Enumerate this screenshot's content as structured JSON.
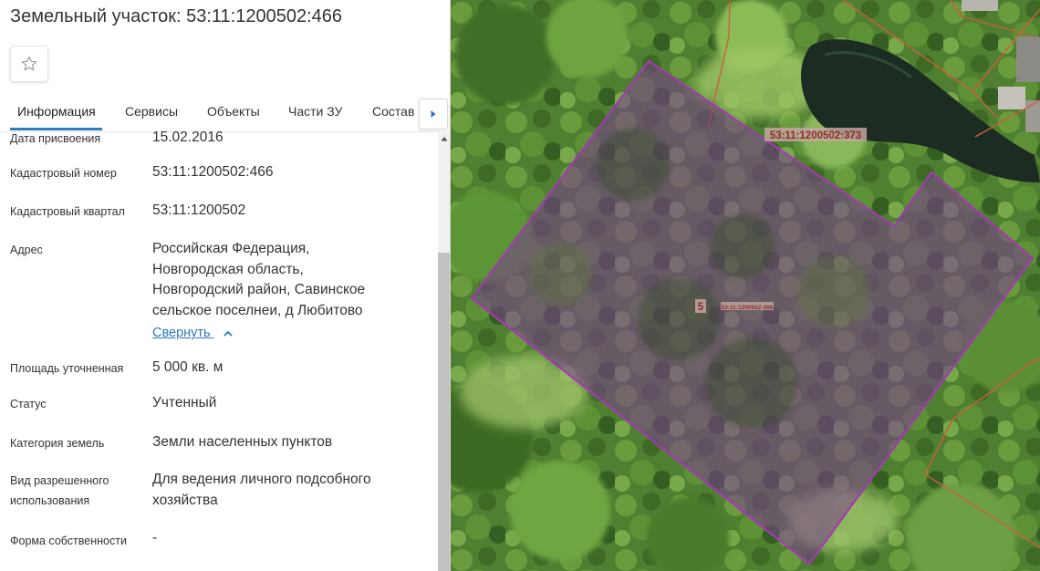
{
  "header": {
    "title": "Земельный участок: 53:11:1200502:466"
  },
  "tabs": [
    {
      "label": "Информация"
    },
    {
      "label": "Сервисы"
    },
    {
      "label": "Объекты"
    },
    {
      "label": "Части ЗУ"
    },
    {
      "label": "Состав"
    }
  ],
  "info": {
    "assign_date": {
      "label": "Дата присвоения",
      "value": "15.02.2016"
    },
    "cadastral_number": {
      "label": "Кадастровый номер",
      "value": "53:11:1200502:466"
    },
    "cadastral_quarter": {
      "label": "Кадастровый квартал",
      "value": "53:11:1200502"
    },
    "address": {
      "label": "Адрес",
      "lines": [
        "Российская Федерация,",
        "Новгородская область,",
        "Новгородский район, Савинское",
        "сельское поселнеи, д Любитово"
      ],
      "collapse_label": "Свернуть"
    },
    "area": {
      "label": "Площадь уточненная",
      "value": "5 000 кв. м"
    },
    "status": {
      "label": "Статус",
      "value": "Учтенный"
    },
    "category": {
      "label": "Категория земель",
      "value": "Земли населенных пунктов"
    },
    "permitted_use": {
      "label_lines": [
        "Вид разрешенного",
        "использования"
      ],
      "value_lines": [
        "Для ведения личного подсобного",
        "хозяйства"
      ]
    },
    "ownership": {
      "label": "Форма собственности",
      "value": "-"
    }
  },
  "map": {
    "neighbor_parcel_label": "53:11:1200502:373",
    "parcel_marker": "5",
    "parcel_label": "53:11:1200502:466",
    "colors": {
      "selected_border": "#a23bb0",
      "selected_fill": "#7a3d8f",
      "neighbor_border": "#c9603a",
      "label_bg": "#c2a6a1"
    }
  },
  "icons": {
    "favorite": "star-outline-icon",
    "tabs_next": "caret-right-icon",
    "collapse": "chevron-up-icon",
    "scroll_up": "caret-up-icon"
  }
}
